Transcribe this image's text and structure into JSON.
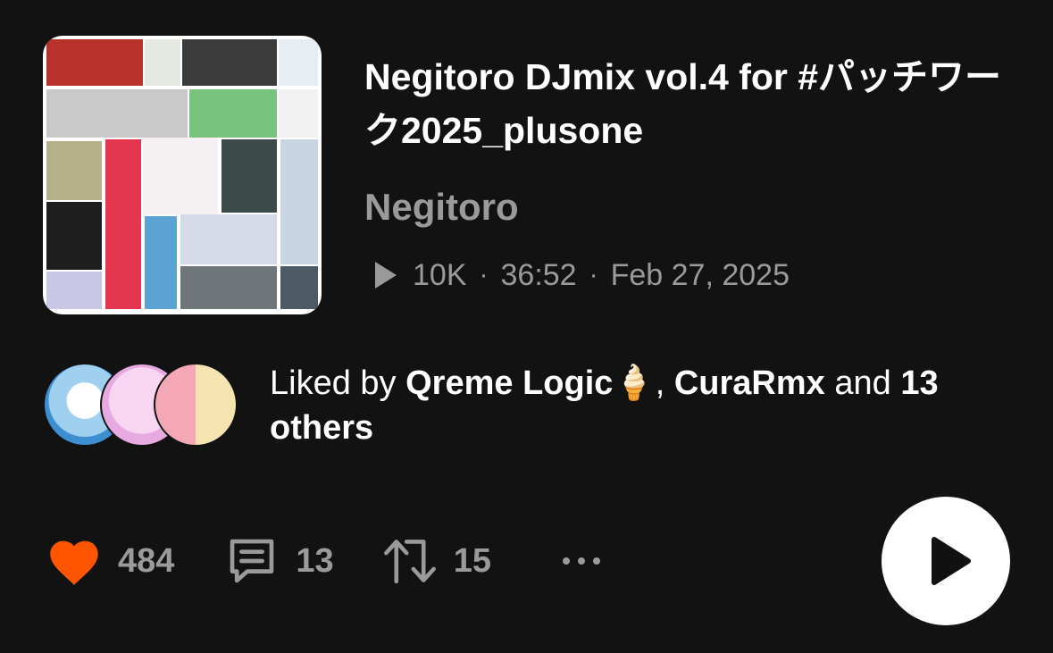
{
  "track": {
    "title": "Negitoro DJmix vol.4 for #パッチワーク2025_plusone",
    "artist": "Negitoro",
    "plays": "10K",
    "duration": "36:52",
    "date": "Feb 27, 2025"
  },
  "separator": "·",
  "liked_by": {
    "prefix": "Liked by",
    "user1": "Qreme Logic",
    "user1_emoji": "🍦",
    "comma": ",",
    "user2": "CuraRmx",
    "conjunction": "and",
    "others": "13 others"
  },
  "actions": {
    "likes": "484",
    "comments": "13",
    "reposts": "15"
  },
  "icons": {
    "heart": "heart-icon",
    "comment": "comment-icon",
    "repost": "repost-icon",
    "more": "more-icon",
    "play": "play-icon"
  },
  "colors": {
    "background": "#121212",
    "heart": "#ff5500",
    "muted": "#9a9a9a",
    "text": "#ffffff"
  }
}
